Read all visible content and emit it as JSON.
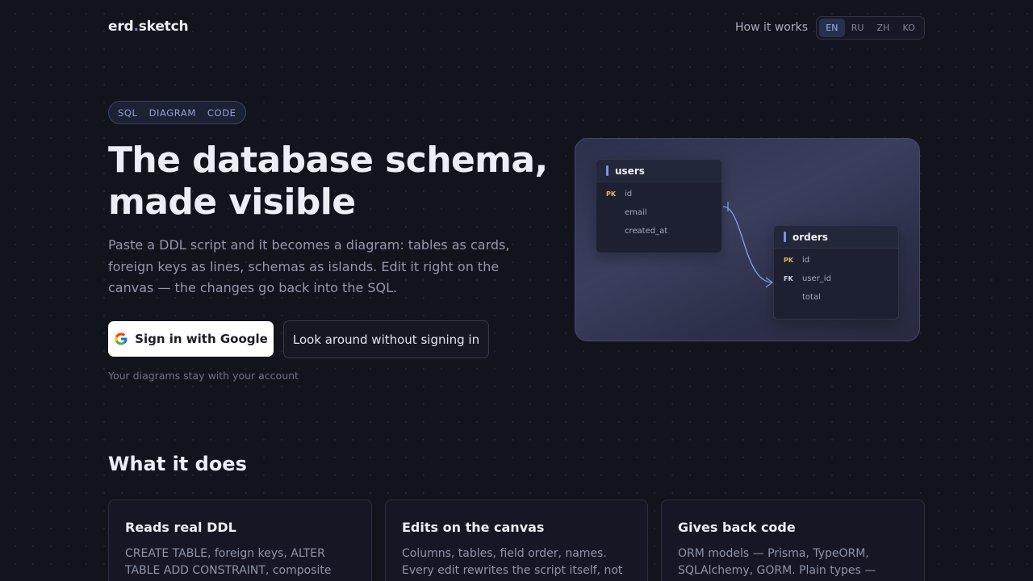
{
  "header": {
    "logo_left": "erd",
    "logo_dot": ".",
    "logo_right": "sketch",
    "how_link": "How it works",
    "languages": [
      "EN",
      "RU",
      "ZH",
      "KO"
    ],
    "active_language": "EN"
  },
  "hero": {
    "tags": [
      "SQL",
      "DIAGRAM",
      "CODE"
    ],
    "headline_line1": "The database schema,",
    "headline_line2": "made visible",
    "subtitle": "Paste a DDL script and it becomes a diagram: tables as cards, foreign keys as lines, schemas as islands. Edit it right on the canvas — the changes go back into the SQL.",
    "google_button": "Sign in with Google",
    "guest_button": "Look around without signing in",
    "note": "Your diagrams stay with your account"
  },
  "diagram": {
    "tables": [
      {
        "name": "users",
        "columns": [
          {
            "key": "PK",
            "name": "id"
          },
          {
            "key": "",
            "name": "email"
          },
          {
            "key": "",
            "name": "created_at"
          }
        ]
      },
      {
        "name": "orders",
        "columns": [
          {
            "key": "PK",
            "name": "id"
          },
          {
            "key": "FK",
            "name": "user_id"
          },
          {
            "key": "",
            "name": "total"
          }
        ]
      }
    ],
    "link_color": "#8ba2e6"
  },
  "features": {
    "title": "What it does",
    "cards": [
      {
        "title": "Reads real DDL",
        "text": "CREATE TABLE, foreign keys, ALTER TABLE ADD CONSTRAINT, composite and self-"
      },
      {
        "title": "Edits on the canvas",
        "text": "Columns, tables, field order, names. Every edit rewrites the script itself, not just the"
      },
      {
        "title": "Gives back code",
        "text": "ORM models — Prisma, TypeORM, SQLAlchemy, GORM. Plain types —"
      }
    ]
  },
  "colors": {
    "background": "#12141d",
    "accent": "#7c93e6",
    "pk": "#e3b45c"
  }
}
